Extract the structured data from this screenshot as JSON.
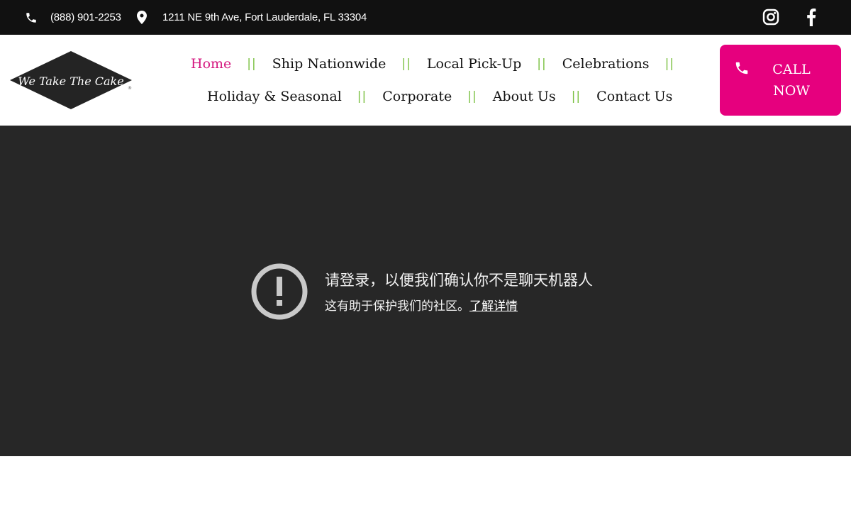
{
  "topbar": {
    "phone": "(888) 901-2253",
    "address": "1211 NE 9th Ave, Fort Lauderdale, FL 33304",
    "icons": [
      "phone-icon",
      "map-pin-icon",
      "instagram-icon",
      "facebook-icon"
    ]
  },
  "logo": {
    "text": "We Take The Cake"
  },
  "nav": {
    "row1": [
      {
        "label": "Home",
        "active": true
      },
      {
        "label": "Ship Nationwide"
      },
      {
        "label": "Local Pick-Up"
      },
      {
        "label": "Celebrations"
      }
    ],
    "row2": [
      {
        "label": "Holiday & Seasonal"
      },
      {
        "label": "Corporate"
      },
      {
        "label": "About Us"
      },
      {
        "label": "Contact Us"
      }
    ],
    "separator": "||"
  },
  "call_button": {
    "line1": "CALL",
    "line2": "NOW"
  },
  "notice": {
    "title": "请登录，以便我们确认你不是聊天机器人",
    "subtitle": "这有助于保护我们的社区。",
    "link": "了解详情"
  },
  "colors": {
    "accent_pink": "#e6007e",
    "active_nav": "#d4177f",
    "separator_green": "#7cc144",
    "topbar_bg": "#111111",
    "notice_bg": "#272727"
  }
}
